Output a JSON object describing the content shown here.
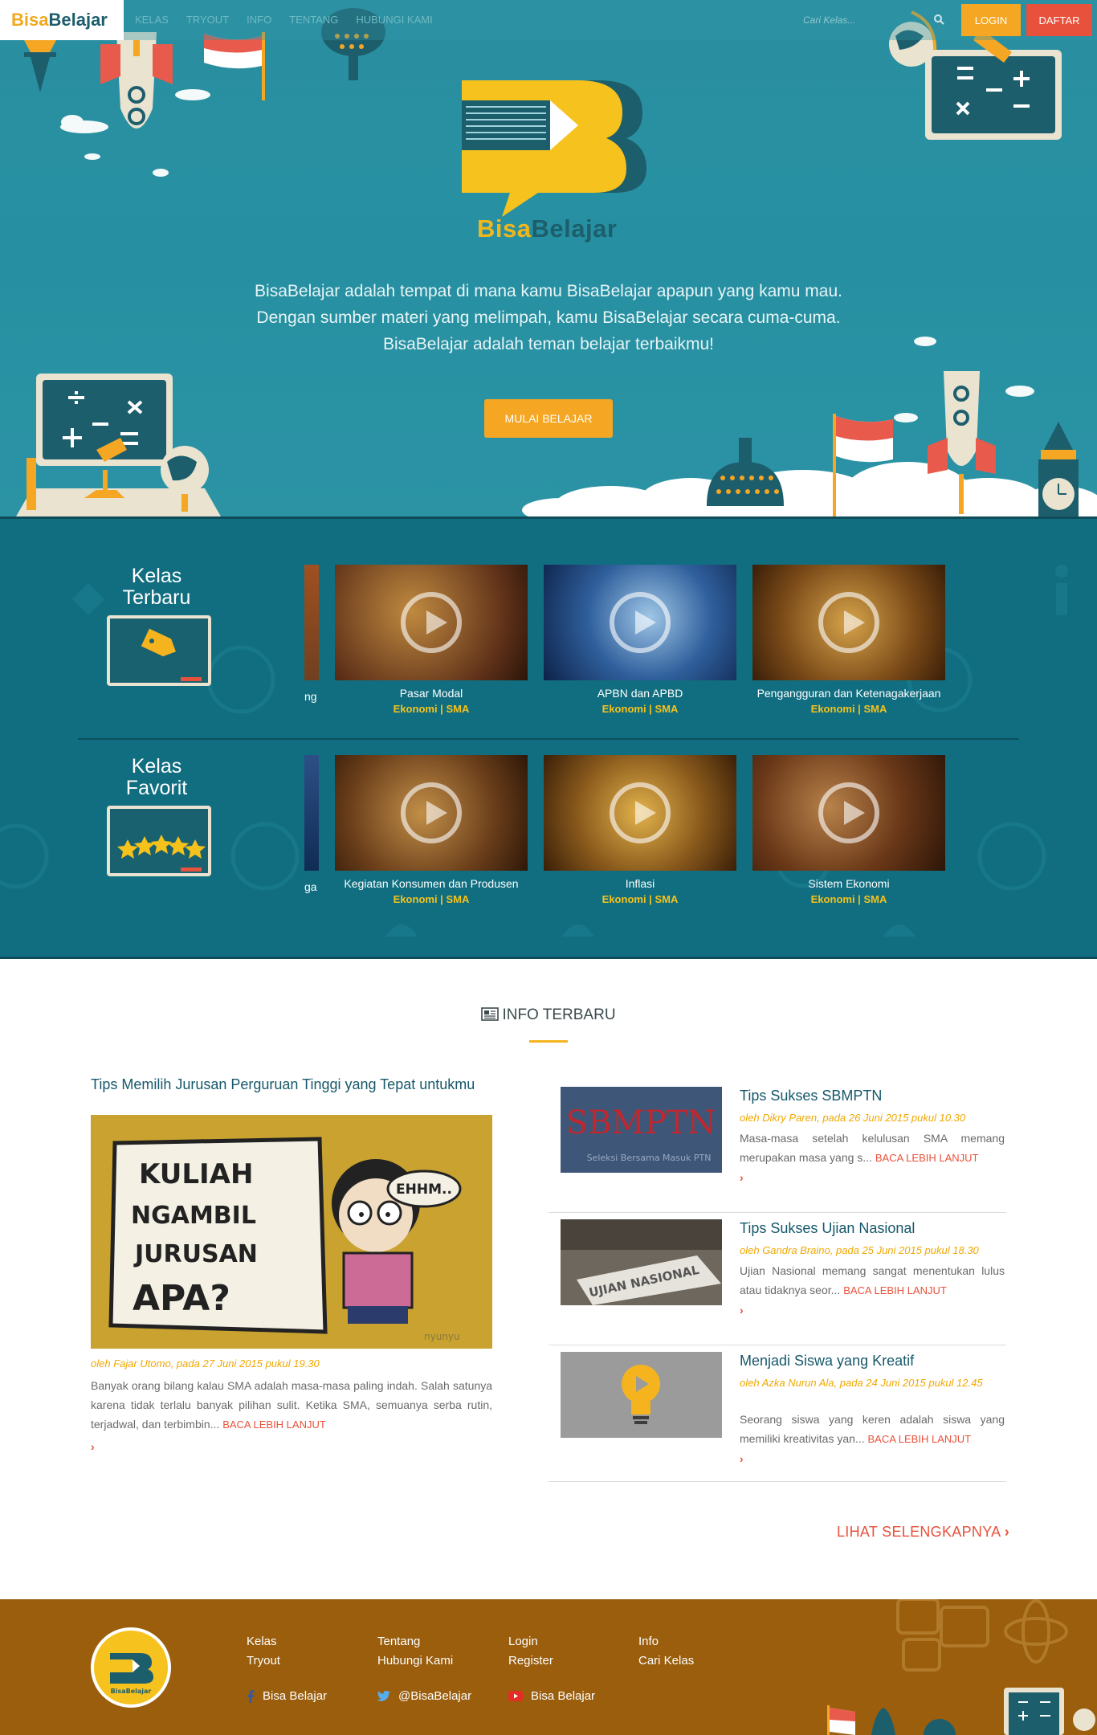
{
  "colors": {
    "primary_teal": "#2a8fa0",
    "dark_teal": "#116e80",
    "accent_orange": "#f5a623",
    "accent_red": "#e8513b",
    "footer_brown": "#9a5e0d",
    "link_blue": "#16586a"
  },
  "navbar": {
    "brand_part1": "Bisa",
    "brand_part2": "Belajar",
    "links": [
      "KELAS",
      "TRYOUT",
      "INFO",
      "TENTANG",
      "HUBUNGI KAMI"
    ],
    "search_placeholder": "Cari Kelas...",
    "login_label": "LOGIN",
    "daftar_label": "DAFTAR"
  },
  "hero": {
    "logo_part1": "Bisa",
    "logo_part2": "Belajar",
    "tagline_lines": [
      "BisaBelajar adalah tempat di mana kamu BisaBelajar apapun yang kamu mau.",
      "Dengan sumber materi yang melimpah, kamu BisaBelajar secara cuma-cuma.",
      "BisaBelajar adalah teman belajar terbaikmu!"
    ],
    "cta_label": "MULAI BELAJAR"
  },
  "kelas": {
    "terbaru": {
      "heading_line1": "Kelas",
      "heading_line2": "Terbaru",
      "partial_caption": "ng",
      "cards": [
        {
          "title": "Pasar Modal",
          "subject": "Ekonomi",
          "level": "SMA"
        },
        {
          "title": "APBN dan APBD",
          "subject": "Ekonomi",
          "level": "SMA"
        },
        {
          "title": "Pengangguran dan Ketenagakerjaan",
          "subject": "Ekonomi",
          "level": "SMA"
        }
      ]
    },
    "favorit": {
      "heading_line1": "Kelas",
      "heading_line2": "Favorit",
      "partial_caption": "ga",
      "cards": [
        {
          "title": "Kegiatan Konsumen dan Produsen",
          "subject": "Ekonomi",
          "level": "SMA"
        },
        {
          "title": "Inflasi",
          "subject": "Ekonomi",
          "level": "SMA"
        },
        {
          "title": "Sistem Ekonomi",
          "subject": "Ekonomi",
          "level": "SMA"
        }
      ]
    },
    "meta_separator": " | "
  },
  "info": {
    "heading": "INFO TERBARU",
    "featured": {
      "title": "Tips Memilih Jurusan Perguruan Tinggi yang Tepat untukmu",
      "image_text_lines": [
        "KULIAH",
        "NGAMBIL",
        "JURUSAN",
        "APA?"
      ],
      "image_bubble": "EHHM..",
      "image_watermark": "nyunyu",
      "byline": "oleh Fajar Utomo, pada 27 Juni 2015 pukul 19.30",
      "excerpt": "Banyak orang bilang kalau SMA adalah masa-masa paling indah. Salah satunya karena tidak terlalu banyak pilihan sulit. Ketika SMA, semuanya serba rutin, terjadwal, dan terbimbin...",
      "more_label": "BACA LEBIH LANJUT"
    },
    "side_posts": [
      {
        "title": "Tips Sukses SBMPTN",
        "byline": "oleh Dikry Paren, pada 26 Juni 2015 pukul 10.30",
        "excerpt": "Masa-masa setelah kelulusan SMA memang merupakan masa yang s...",
        "more_label": "BACA LEBIH LANJUT",
        "img_text": "SBMPTN",
        "img_subtext": "Seleksi Bersama Masuk PTN"
      },
      {
        "title": "Tips Sukses Ujian Nasional",
        "byline": "oleh Gandra Braino, pada 25 Juni 2015 pukul 18.30",
        "excerpt": "Ujian Nasional memang sangat menentukan lulus atau tidaknya seor...",
        "more_label": "BACA LEBIH LANJUT",
        "img_text": "UJIAN NASIONAL",
        "img_subtext": ""
      },
      {
        "title": "Menjadi Siswa yang Kreatif",
        "byline": "oleh Azka Nurun Ala, pada 24 Juni 2015 pukul 12.45",
        "excerpt": "Seorang siswa yang keren adalah siswa yang memiliki kreativitas yan...",
        "more_label": "BACA LEBIH LANJUT",
        "img_text": "",
        "img_subtext": ""
      }
    ],
    "see_all_label": "LIHAT SELENGKAPNYA"
  },
  "footer": {
    "logo_part1": "Bisa",
    "logo_part2": "Belajar",
    "links": {
      "col1": [
        "Kelas",
        "Tryout"
      ],
      "col2": [
        "Tentang",
        "Hubungi Kami"
      ],
      "col3": [
        "Login",
        "Register"
      ],
      "col4": [
        "Info",
        "Cari Kelas"
      ]
    },
    "social": {
      "facebook": "Bisa Belajar",
      "twitter": "@BisaBelajar",
      "youtube": "Bisa Belajar"
    }
  }
}
